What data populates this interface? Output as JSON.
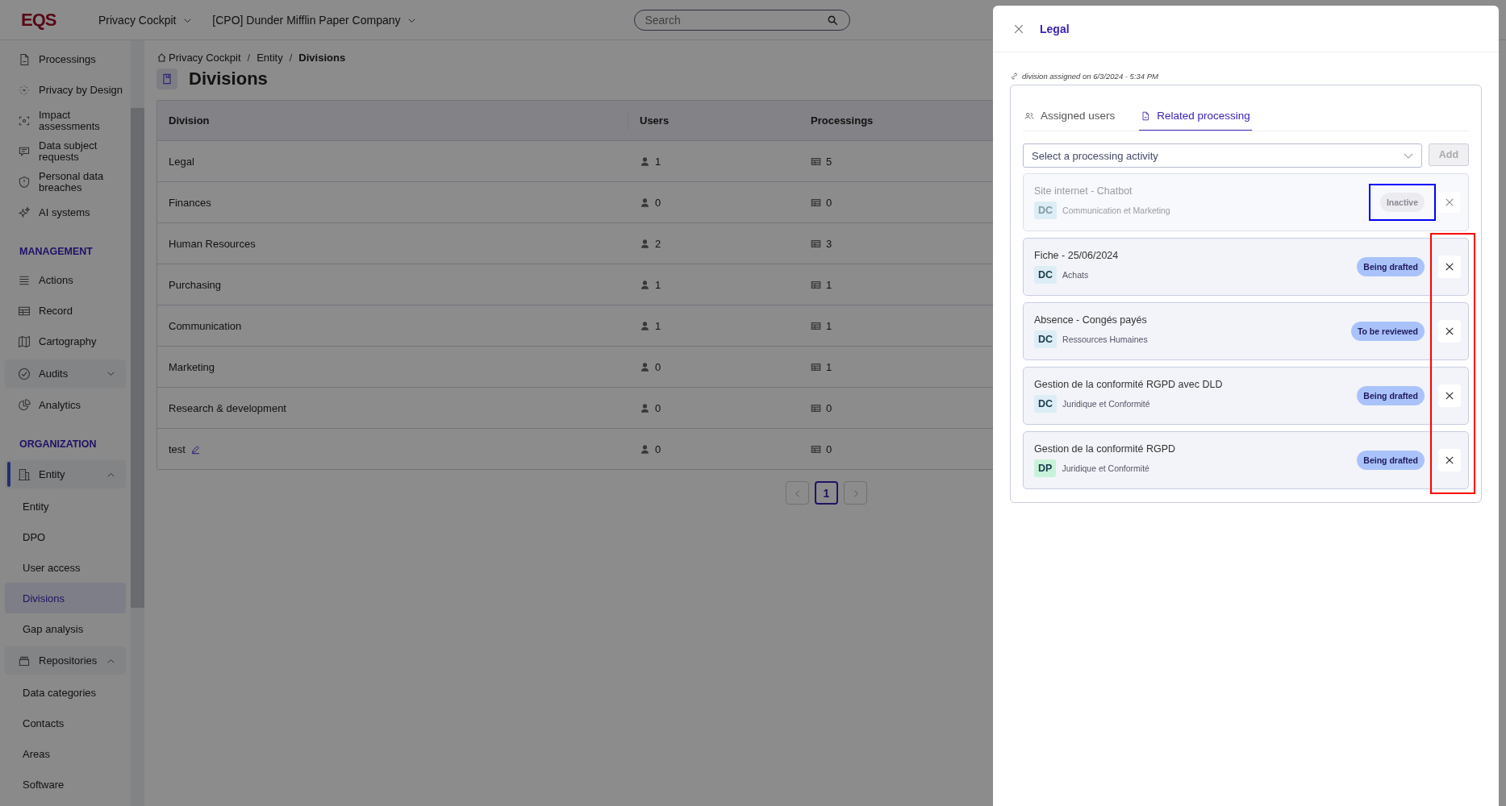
{
  "topbar": {
    "logo": "EQS",
    "module_menu": "Privacy Cockpit",
    "company_menu": "[CPO] Dunder Mifflin Paper Company",
    "search": {
      "placeholder": "Search"
    }
  },
  "sidebar": {
    "items": [
      {
        "kind": "link",
        "label": "Processings",
        "selected": false
      },
      {
        "kind": "link",
        "label": "Privacy by Design",
        "selected": false
      },
      {
        "kind": "link",
        "label": "Impact assessments",
        "selected": false
      },
      {
        "kind": "link",
        "label": "Data subject requests",
        "selected": false
      },
      {
        "kind": "link",
        "label": "Personal data breaches",
        "selected": false
      },
      {
        "kind": "link",
        "label": "AI systems",
        "selected": false
      },
      {
        "kind": "section",
        "label": "MANAGEMENT"
      },
      {
        "kind": "link",
        "label": "Actions",
        "selected": false
      },
      {
        "kind": "link",
        "label": "Record",
        "selected": false
      },
      {
        "kind": "link",
        "label": "Cartography",
        "selected": false
      },
      {
        "kind": "group",
        "label": "Audits",
        "selected": false,
        "expanded": false
      },
      {
        "kind": "link",
        "label": "Analytics",
        "selected": false
      },
      {
        "kind": "section",
        "label": "ORGANIZATION"
      },
      {
        "kind": "group",
        "label": "Entity",
        "selected": true,
        "expanded": true
      },
      {
        "kind": "sub",
        "label": "Entity",
        "selected": false
      },
      {
        "kind": "sub",
        "label": "DPO",
        "selected": false
      },
      {
        "kind": "sub",
        "label": "User access",
        "selected": false
      },
      {
        "kind": "sub",
        "label": "Divisions",
        "selected": true
      },
      {
        "kind": "sub",
        "label": "Gap analysis",
        "selected": false
      },
      {
        "kind": "group",
        "label": "Repositories",
        "selected": false,
        "expanded": true
      },
      {
        "kind": "sub",
        "label": "Data categories",
        "selected": false
      },
      {
        "kind": "sub",
        "label": "Contacts",
        "selected": false
      },
      {
        "kind": "sub",
        "label": "Areas",
        "selected": false
      },
      {
        "kind": "sub",
        "label": "Software",
        "selected": false
      }
    ]
  },
  "breadcrumb": [
    "Privacy Cockpit",
    "Entity",
    "Divisions"
  ],
  "breadcrumb_separator": "/",
  "page_title": "Divisions",
  "table": {
    "columns": [
      "Division",
      "Users",
      "Processings"
    ],
    "rows": [
      {
        "division": "Legal",
        "users": "1",
        "processings": "5",
        "editable": false
      },
      {
        "division": "Finances",
        "users": "0",
        "processings": "0",
        "editable": false
      },
      {
        "division": "Human Resources",
        "users": "2",
        "processings": "3",
        "editable": false
      },
      {
        "division": "Purchasing",
        "users": "1",
        "processings": "1",
        "editable": false
      },
      {
        "division": "Communication",
        "users": "1",
        "processings": "1",
        "editable": false
      },
      {
        "division": "Marketing",
        "users": "0",
        "processings": "1",
        "editable": false
      },
      {
        "division": "Research & development",
        "users": "0",
        "processings": "0",
        "editable": false
      },
      {
        "division": "test",
        "users": "0",
        "processings": "0",
        "editable": true
      }
    ]
  },
  "pagination": {
    "pages": [
      {
        "label": "1",
        "selected": true
      }
    ]
  },
  "panel": {
    "title": "Legal",
    "assigned_note": "division assigned on 6/3/2024 - 5:34 PM",
    "tabs": [
      {
        "label": "Assigned users",
        "selected": false
      },
      {
        "label": "Related processing",
        "selected": true
      }
    ],
    "select": {
      "placeholder": "Select a processing activity"
    },
    "add_button": {
      "label": "Add",
      "disabled": true
    },
    "items": [
      {
        "title": "Site internet - Chatbot",
        "tag": {
          "label": "DC",
          "color": "#dcedf5"
        },
        "department": "Communication et Marketing",
        "status": {
          "label": "Inactive",
          "kind": "inactive"
        },
        "inactive": true,
        "status_highlighted": true,
        "remove_highlighted": false
      },
      {
        "title": "Fiche - 25/06/2024",
        "tag": {
          "label": "DC",
          "color": "#dcedf5"
        },
        "department": "Achats",
        "status": {
          "label": "Being drafted",
          "kind": "draft"
        },
        "inactive": false,
        "status_highlighted": false,
        "remove_highlighted": true
      },
      {
        "title": "Absence - Congés payés",
        "tag": {
          "label": "DC",
          "color": "#dcedf5"
        },
        "department": "Ressources Humaines",
        "status": {
          "label": "To be reviewed",
          "kind": "review"
        },
        "inactive": false,
        "status_highlighted": false,
        "remove_highlighted": true
      },
      {
        "title": "Gestion de la conformité RGPD avec DLD",
        "tag": {
          "label": "DC",
          "color": "#dcedf5"
        },
        "department": "Juridique et Conformité",
        "status": {
          "label": "Being drafted",
          "kind": "draft"
        },
        "inactive": false,
        "status_highlighted": false,
        "remove_highlighted": true
      },
      {
        "title": "Gestion de la conformité RGPD",
        "tag": {
          "label": "DP",
          "color": "#c8f2da"
        },
        "department": "Juridique et Conformité",
        "status": {
          "label": "Being drafted",
          "kind": "draft"
        },
        "inactive": false,
        "status_highlighted": false,
        "remove_highlighted": true
      }
    ]
  }
}
